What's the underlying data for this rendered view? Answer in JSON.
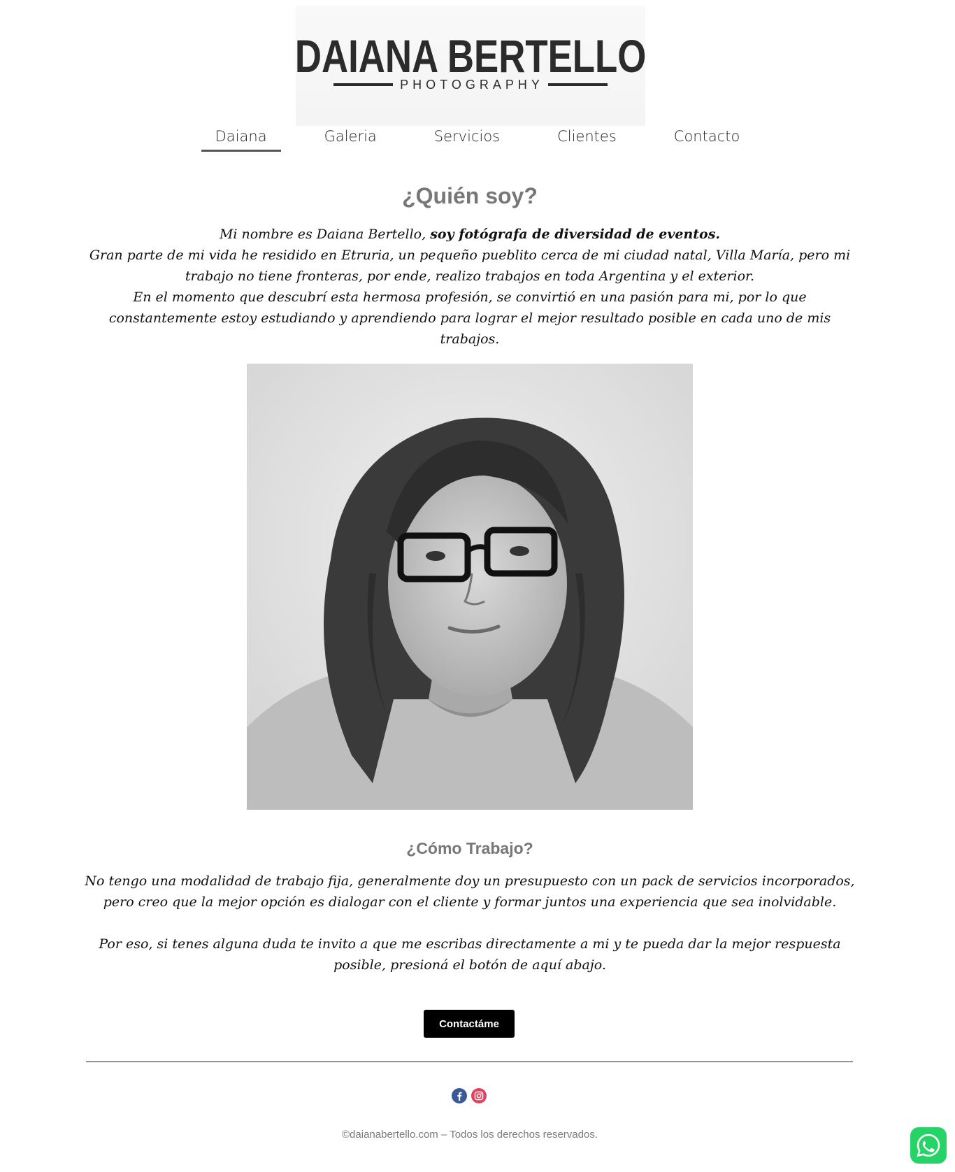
{
  "brand": {
    "name": "DAIANA BERTELLO",
    "tagline": "PHOTOGRAPHY"
  },
  "nav": {
    "items": [
      {
        "label": "Daiana",
        "active": true
      },
      {
        "label": "Galeria",
        "active": false
      },
      {
        "label": "Servicios",
        "active": false
      },
      {
        "label": "Clientes",
        "active": false
      },
      {
        "label": "Contacto",
        "active": false
      }
    ]
  },
  "about": {
    "title": "¿Quién soy?",
    "intro_plain": "Mi nombre es Daiana Bertello, ",
    "intro_bold": "soy fotógrafa de diversidad de eventos.",
    "paragraph2": "Gran parte de mi vida he residido en Etruria, un pequeño pueblito cerca de mi ciudad natal, Villa María, pero mi trabajo no tiene fronteras, por ende, realizo trabajos en toda Argentina y el exterior.",
    "paragraph3": "En el momento que descubrí esta hermosa profesión, se convirtió en una pasión para mi, por lo que constantemente estoy estudiando y aprendiendo para lograr el mejor resultado posible en cada uno de mis trabajos."
  },
  "work": {
    "title": "¿Cómo Trabajo?",
    "paragraph1": "No tengo una modalidad de trabajo fija, generalmente doy un presupuesto con un pack de servicios incorporados, pero creo que la mejor opción es dialogar con el cliente y formar juntos una experiencia que sea inolvidable.",
    "paragraph2": "Por eso, si tenes alguna duda te invito a que me escribas directamente a mi y te pueda dar la mejor respuesta posible, presioná el botón de aquí abajo.",
    "cta_label": "Contactáme"
  },
  "footer": {
    "copyright": "©daianabertello.com – Todos los derechos reservados.",
    "social": [
      {
        "icon": "facebook-icon",
        "color": "#3b5998"
      },
      {
        "icon": "instagram-icon",
        "color": "#e4405f"
      }
    ]
  },
  "floating": {
    "icon": "whatsapp-icon",
    "color": "#25d366"
  }
}
